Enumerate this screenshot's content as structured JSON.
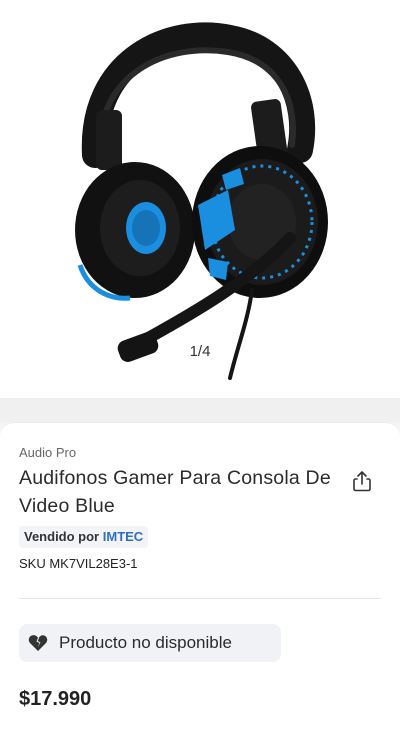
{
  "gallery": {
    "image_alt": "Audifonos Gamer negro con azul",
    "counter": "1/4"
  },
  "product": {
    "brand": "Audio Pro",
    "title": "Audifonos Gamer Para Consola De Video Blue",
    "seller_prefix": "Vendido por",
    "seller_name": "IMTEC",
    "sku": "SKU MK7VIL28E3-1",
    "availability": "Producto no disponible",
    "price": "$17.990"
  },
  "icons": {
    "share": "share-icon",
    "availability": "broken-heart-icon"
  },
  "colors": {
    "seller_link": "#2f6ec4",
    "headset_accent": "#1a8fe0"
  }
}
